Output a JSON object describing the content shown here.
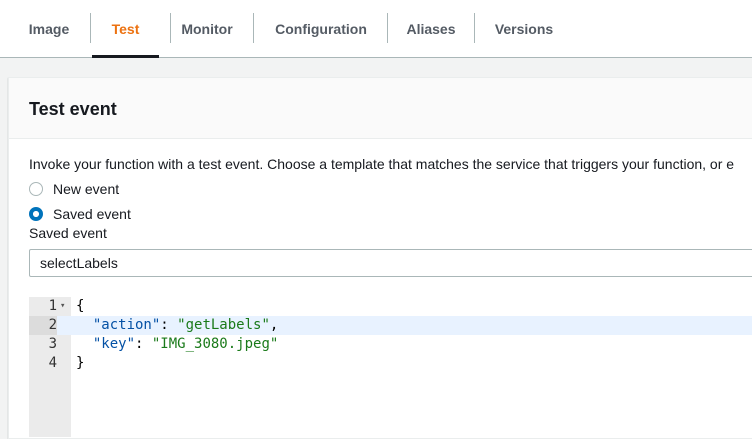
{
  "tabs": [
    {
      "label": "Image",
      "active": false
    },
    {
      "label": "Test",
      "active": true
    },
    {
      "label": "Monitor",
      "active": false
    },
    {
      "label": "Configuration",
      "active": false
    },
    {
      "label": "Aliases",
      "active": false
    },
    {
      "label": "Versions",
      "active": false
    }
  ],
  "colors": {
    "active_tab": "#ec7211",
    "radio_selected": "#0073bb"
  },
  "panel": {
    "title": "Test event",
    "description": "Invoke your function with a test event. Choose a template that matches the service that triggers your function, or e",
    "radios": [
      {
        "label": "New event",
        "selected": false
      },
      {
        "label": "Saved event",
        "selected": true
      }
    ],
    "saved_event_label": "Saved event",
    "saved_event_value": "selectLabels"
  },
  "editor": {
    "lines": [
      {
        "number": "1",
        "text": "{"
      },
      {
        "number": "2",
        "key": "\"action\"",
        "sep": ": ",
        "value": "\"getLabels\"",
        "tail": ","
      },
      {
        "number": "3",
        "key": "\"key\"",
        "sep": ": ",
        "value": "\"IMG_3080.jpeg\"",
        "tail": ""
      },
      {
        "number": "4",
        "text": "}"
      }
    ],
    "fold_icon": "fold-arrow-icon",
    "current_line": 2
  }
}
